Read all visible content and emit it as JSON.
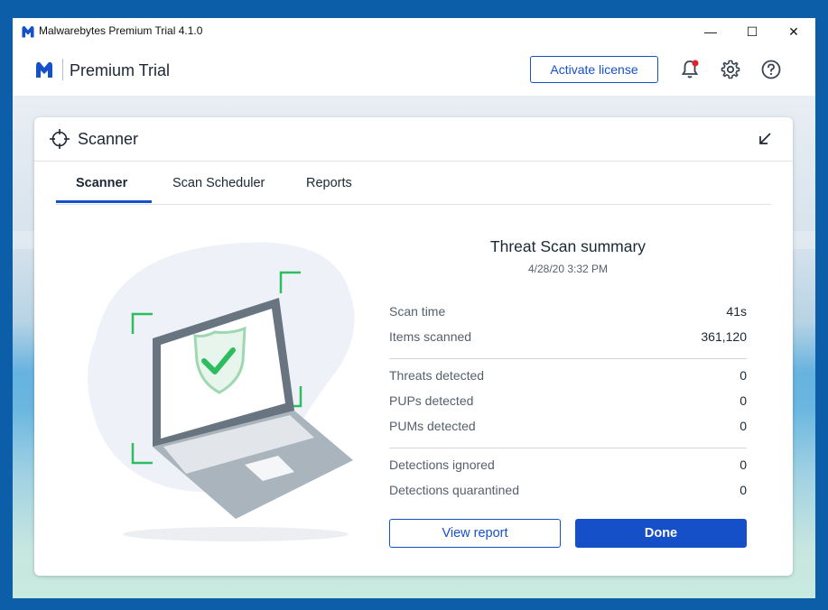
{
  "window": {
    "title": "Malwarebytes Premium Trial  4.1.0",
    "minimize": "—",
    "maximize": "☐",
    "close": "✕"
  },
  "header": {
    "brand": "Premium Trial",
    "activate_label": "Activate license",
    "icons": [
      "bell-icon",
      "gear-icon",
      "help-icon"
    ],
    "accent": "#1550c8",
    "notification_dot": "#e0202b"
  },
  "card": {
    "title": "Scanner",
    "tabs": [
      {
        "label": "Scanner",
        "active": true
      },
      {
        "label": "Scan Scheduler",
        "active": false
      },
      {
        "label": "Reports",
        "active": false
      }
    ]
  },
  "summary": {
    "title": "Threat Scan summary",
    "date": "4/28/20 3:32 PM",
    "rows": [
      {
        "label": "Scan time",
        "value": "41s"
      },
      {
        "label": "Items scanned",
        "value": "361,120"
      },
      {
        "label": "Threats detected",
        "value": "0"
      },
      {
        "label": "PUPs detected",
        "value": "0"
      },
      {
        "label": "PUMs detected",
        "value": "0"
      },
      {
        "label": "Detections ignored",
        "value": "0"
      },
      {
        "label": "Detections quarantined",
        "value": "0"
      }
    ],
    "view_report_label": "View report",
    "done_label": "Done"
  }
}
